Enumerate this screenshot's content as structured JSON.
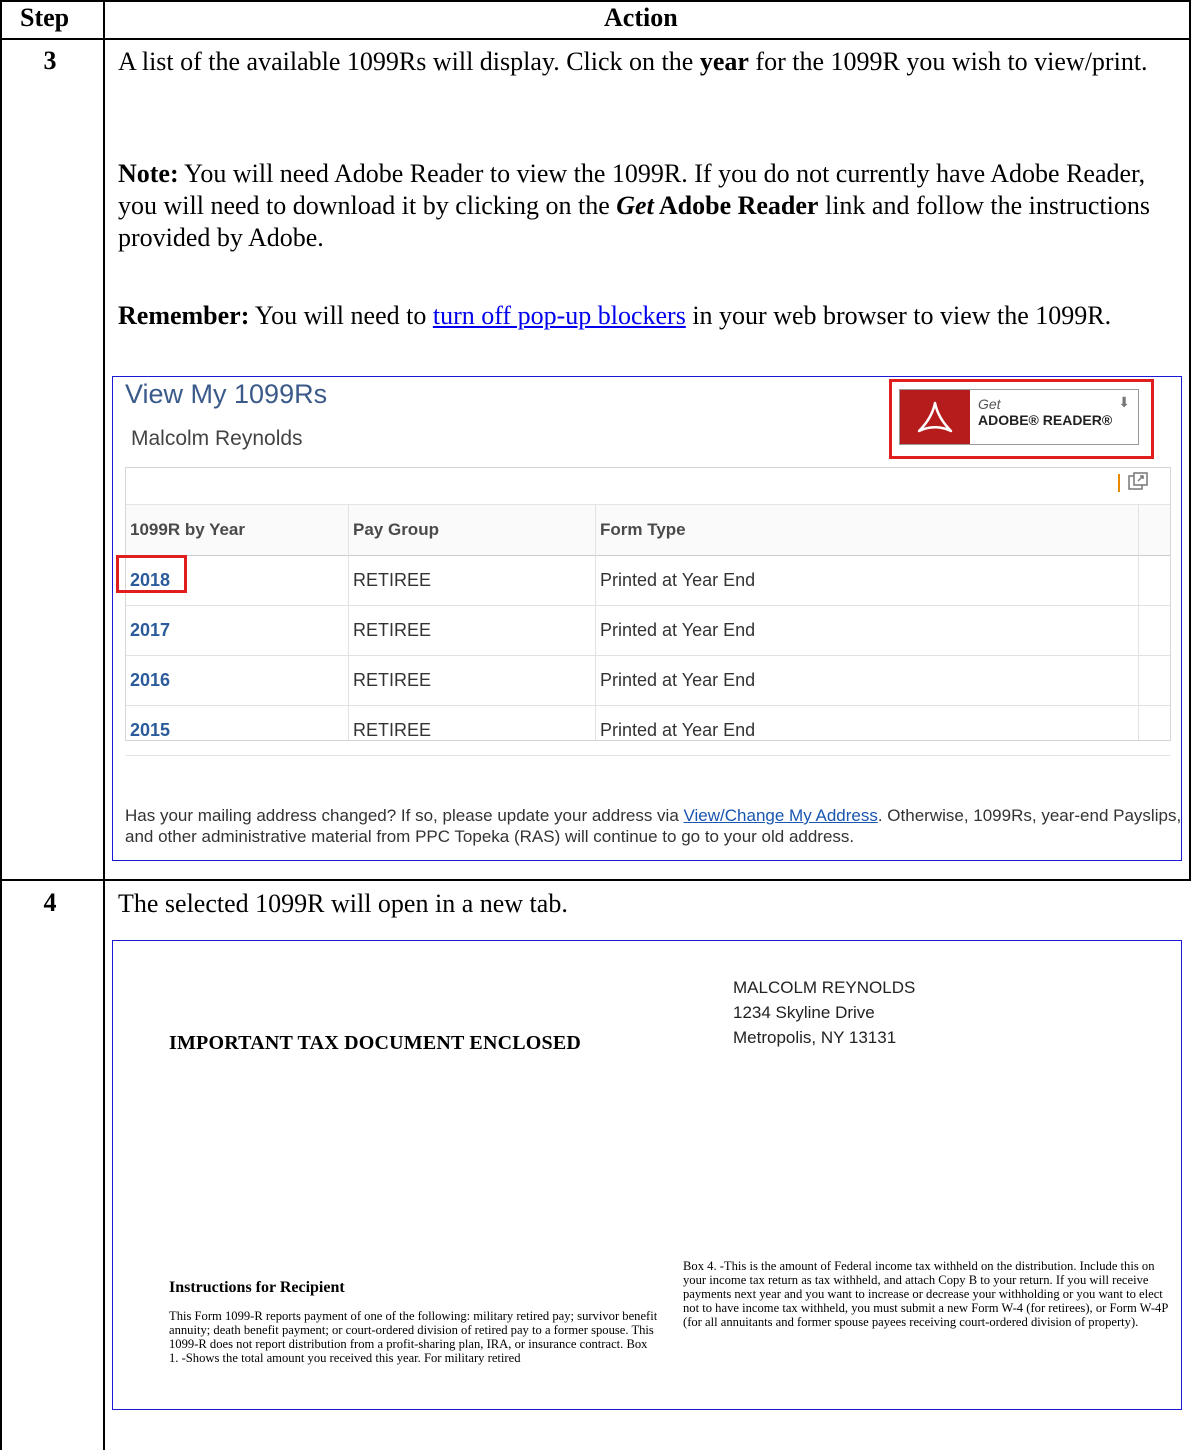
{
  "table": {
    "header_step": "Step",
    "header_action": "Action"
  },
  "step3": {
    "number": "3",
    "intro_a": "A list of the available 1099Rs will display.  Click on the ",
    "intro_bold": "year",
    "intro_b": " for the 1099R you wish to view/print.",
    "note_label": "Note:",
    "note_a": "  You will need Adobe Reader to view the 1099R.  If you do not currently have Adobe Reader, you will need to download it by clicking on the ",
    "note_get": "Get",
    "note_adobe_reader": " Adobe Reader",
    "note_b": " link and follow the instructions provided by Adobe.",
    "remember_label": "Remember:",
    "remember_a": "  You will need to ",
    "remember_link": "turn off pop-up blockers",
    "remember_b": " in your web browser to view the 1099R."
  },
  "view1099": {
    "title": "View My 1099Rs",
    "user_name": "Malcolm Reynolds",
    "adobe": {
      "get": "Get",
      "reader": "ADOBE® READER®"
    },
    "columns": [
      "1099R by Year",
      "Pay Group",
      "Form Type"
    ],
    "rows": [
      {
        "year": "2018",
        "pay_group": "RETIREE",
        "form_type": "Printed at Year End"
      },
      {
        "year": "2017",
        "pay_group": "RETIREE",
        "form_type": "Printed at Year End"
      },
      {
        "year": "2016",
        "pay_group": "RETIREE",
        "form_type": "Printed at Year End"
      },
      {
        "year": "2015",
        "pay_group": "RETIREE",
        "form_type": "Printed at Year End"
      }
    ],
    "footer_a": "Has your mailing address changed? If so, please update your address via ",
    "footer_link": "View/Change My Address",
    "footer_b": ". Otherwise, 1099Rs, year-end Payslips, and other administrative material from PPC Topeka (RAS) will continue to go to your old address.",
    "highlight_color": "#e01e1e",
    "link_color": "#2b5b9a"
  },
  "step4": {
    "number": "4",
    "text": "The selected 1099R will open in a new tab."
  },
  "taxdoc": {
    "address_name": "MALCOLM REYNOLDS",
    "address_street": "1234 Skyline Drive",
    "address_city": "Metropolis, NY  13131",
    "heading": "IMPORTANT TAX DOCUMENT ENCLOSED",
    "instructions_title": "Instructions for Recipient",
    "instructions_body": "This Form 1099-R reports payment of one of the following: military retired pay; survivor benefit annuity; death benefit payment; or court-ordered division of retired pay to a former spouse. This 1099-R does not report distribution from a profit-sharing plan, IRA, or insurance contract. Box 1. -Shows the total amount you received this year. For military retired",
    "box4_text": "Box 4. -This is the amount of Federal income tax withheld on the distribution. Include this on your income tax return as tax withheld, and attach Copy B to your return. If you will receive payments next year and you want to increase or decrease your withholding or you want to elect not to have income tax withheld, you must submit a new Form W-4 (for retirees), or Form W-4P (for all annuitants and former spouse payees receiving court-ordered division of property)."
  }
}
